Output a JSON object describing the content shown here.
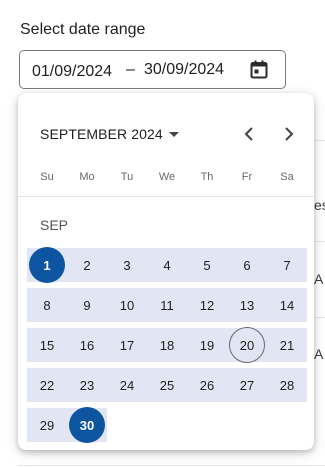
{
  "field": {
    "label": "Select date range",
    "start_value": "01/09/2024",
    "separator": "–",
    "end_value": "30/09/2024"
  },
  "calendar": {
    "month_label": "SEPTEMBER 2024",
    "month_heading": "SEP",
    "weekdays": [
      "Su",
      "Mo",
      "Tu",
      "We",
      "Th",
      "Fr",
      "Sa"
    ],
    "days": [
      1,
      2,
      3,
      4,
      5,
      6,
      7,
      8,
      9,
      10,
      11,
      12,
      13,
      14,
      15,
      16,
      17,
      18,
      19,
      20,
      21,
      22,
      23,
      24,
      25,
      26,
      27,
      28,
      29,
      30
    ],
    "range_start": 1,
    "range_end": 30,
    "today": 20
  },
  "background": {
    "fragments": [
      "es",
      "A",
      "A"
    ]
  },
  "colors": {
    "selected": "#0d55a1",
    "range_band": "#e2e5f3",
    "today_ring": "#6b6b6b"
  }
}
